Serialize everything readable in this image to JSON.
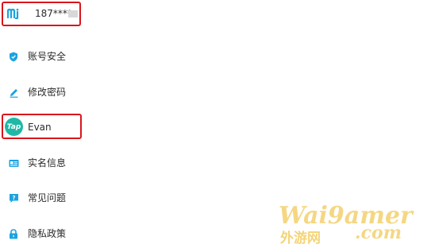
{
  "account": {
    "logo": "mi-logo-icon",
    "phone": "187****"
  },
  "menu": [
    {
      "icon": "shield-icon",
      "label": "账号安全"
    },
    {
      "icon": "pencil-icon",
      "label": "修改密码"
    },
    {
      "icon": "taptap-logo-icon",
      "logo_text": "Tap",
      "label": "Evan"
    },
    {
      "icon": "id-card-icon",
      "label": "实名信息"
    },
    {
      "icon": "help-icon",
      "label": "常见问题"
    },
    {
      "icon": "lock-icon",
      "label": "隐私政策"
    }
  ],
  "watermark": {
    "brand": "Wai9amer",
    "sub": "外游网",
    "domain": ".com"
  },
  "colors": {
    "accent": "#1aa3e0",
    "tap_green": "#1fb8a6",
    "highlight": "#d9161c",
    "watermark": "#ecb71e"
  }
}
